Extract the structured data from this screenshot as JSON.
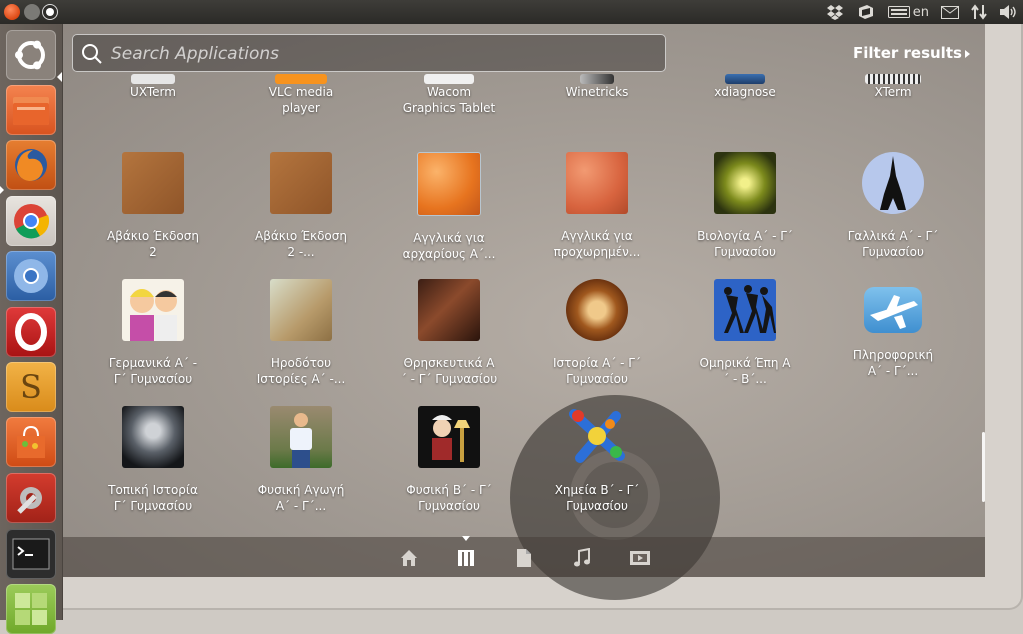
{
  "search": {
    "placeholder": "Search Applications"
  },
  "filter": {
    "label": "Filter results"
  },
  "indicators": {
    "keyboard": "en"
  },
  "launcher": {
    "items": [
      {
        "icon": "ubuntu-dash-icon"
      },
      {
        "icon": "home-folder-icon"
      },
      {
        "icon": "firefox-icon"
      },
      {
        "icon": "chrome-icon"
      },
      {
        "icon": "chromium-icon"
      },
      {
        "icon": "opera-icon"
      },
      {
        "icon": "sublime-text-icon"
      },
      {
        "icon": "software-center-icon"
      },
      {
        "icon": "system-settings-icon"
      },
      {
        "icon": "terminal-icon"
      },
      {
        "icon": "workspace-switcher-icon"
      }
    ]
  },
  "apps": {
    "row0": [
      {
        "label": "UXTerm"
      },
      {
        "label": "VLC media\nplayer"
      },
      {
        "label": "Wacom\nGraphics Tablet"
      },
      {
        "label": "Winetricks"
      },
      {
        "label": "xdiagnose"
      },
      {
        "label": "XTerm"
      }
    ],
    "row1": [
      {
        "label": "Αβάκιο Έκδοση\n2"
      },
      {
        "label": "Αβάκιο Έκδοση\n2 -..."
      },
      {
        "label": "Αγγλικά για\nαρχαρίους Α΄..."
      },
      {
        "label": "Αγγλικά για\nπροχωρημέν..."
      },
      {
        "label": "Βιολογία Α΄ - Γ΄\nΓυμνασίου"
      },
      {
        "label": "Γαλλικά Α΄ - Γ΄\nΓυμνασίου"
      }
    ],
    "row2": [
      {
        "label": "Γερμανικά Α΄ -\nΓ΄ Γυμνασίου"
      },
      {
        "label": "Ηροδότου\nΙστορίες Α΄ -..."
      },
      {
        "label": "Θρησκευτικά Α\n΄ - Γ΄ Γυμνασίου"
      },
      {
        "label": "Ιστορία Α΄ - Γ΄\nΓυμνασίου"
      },
      {
        "label": "Ομηρικά Έπη Α\n΄ - Β΄..."
      },
      {
        "label": "Πληροφορική\nΑ΄ - Γ΄..."
      }
    ],
    "row3": [
      {
        "label": "Τοπική Ιστορία\nΓ΄ Γυμνασίου"
      },
      {
        "label": "Φυσική Αγωγή\nΑ΄ - Γ΄..."
      },
      {
        "label": "Φυσική Β΄ - Γ΄\nΓυμνασίου"
      },
      {
        "label": "Χημεία Β΄ - Γ΄\nΓυμνασίου"
      }
    ]
  },
  "lenses": [
    {
      "icon": "home-lens-icon"
    },
    {
      "icon": "applications-lens-icon",
      "active": true
    },
    {
      "icon": "files-lens-icon"
    },
    {
      "icon": "music-lens-icon"
    },
    {
      "icon": "video-lens-icon"
    }
  ],
  "colors": {
    "accent": "#dd4814",
    "panel": "#2b2a27"
  }
}
